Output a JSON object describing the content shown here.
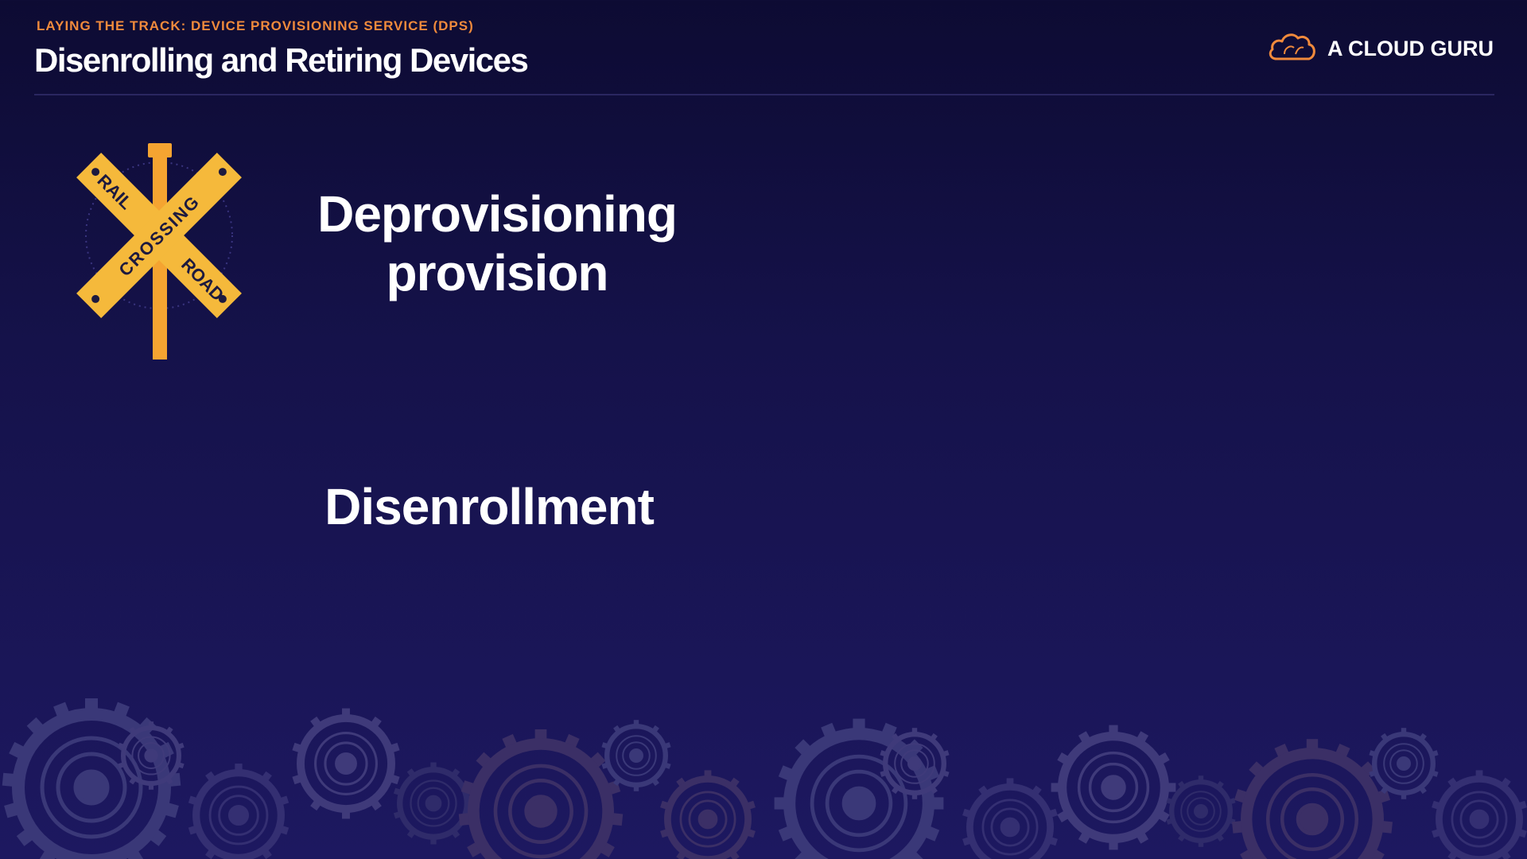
{
  "header": {
    "eyebrow": "LAYING THE TRACK: DEVICE PROVISIONING SERVICE (DPS)",
    "title": "Disenrolling and Retiring Devices"
  },
  "brand": {
    "name": "A CLOUD GURU",
    "icon": "cloud-icon"
  },
  "sign": {
    "icon": "railroad-crossing-icon",
    "word_left_top": "RAIL",
    "word_center": "CROSSING",
    "word_right_bottom": "ROAD"
  },
  "terms": {
    "first_line1": "Deprovisioning",
    "first_line2": "provision",
    "second": "Disenrollment"
  },
  "colors": {
    "accent": "#f08a3c",
    "sign_yellow": "#f5b93b",
    "background": "#15124a"
  }
}
